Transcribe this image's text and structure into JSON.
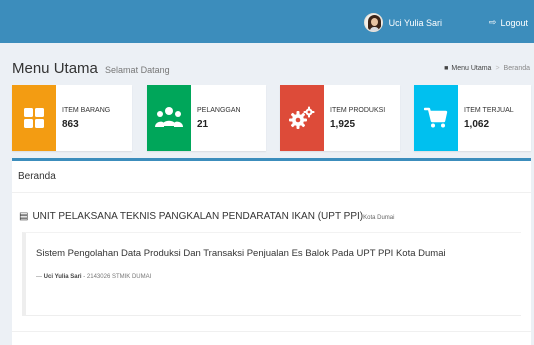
{
  "header": {
    "user_name": "Uci Yulia Sari",
    "logout_label": "Logout",
    "brand_color": "#3c8dbc"
  },
  "page": {
    "title": "Menu Utama",
    "subtitle": "Selamat Datang",
    "breadcrumb": [
      "Menu Utama",
      "Beranda"
    ]
  },
  "stats": [
    {
      "label": "ITEM BARANG",
      "value": "863",
      "icon": "grid-icon",
      "color": "#f39c12"
    },
    {
      "label": "PELANGGAN",
      "value": "21",
      "icon": "users-icon",
      "color": "#00a65a"
    },
    {
      "label": "ITEM PRODUKSI",
      "value": "1,925",
      "icon": "gears-icon",
      "color": "#dd4b39"
    },
    {
      "label": "ITEM TERJUAL",
      "value": "1,062",
      "icon": "cart-icon",
      "color": "#00c0ef"
    }
  ],
  "panel": {
    "header": "Beranda",
    "unit_title": "UNIT PELAKSANA TEKNIS PANGKALAN PENDARATAN IKAN (UPT PPI)",
    "unit_suffix": "Kota Dumai",
    "quote": "Sistem Pengolahan Data Produksi Dan Transaksi Penjualan Es Balok Pada UPT PPI Kota Dumai",
    "author_dash": "— ",
    "author_name": "Uci Yulia Sari",
    "author_info": " - 2143026 STMIK DUMAI"
  }
}
